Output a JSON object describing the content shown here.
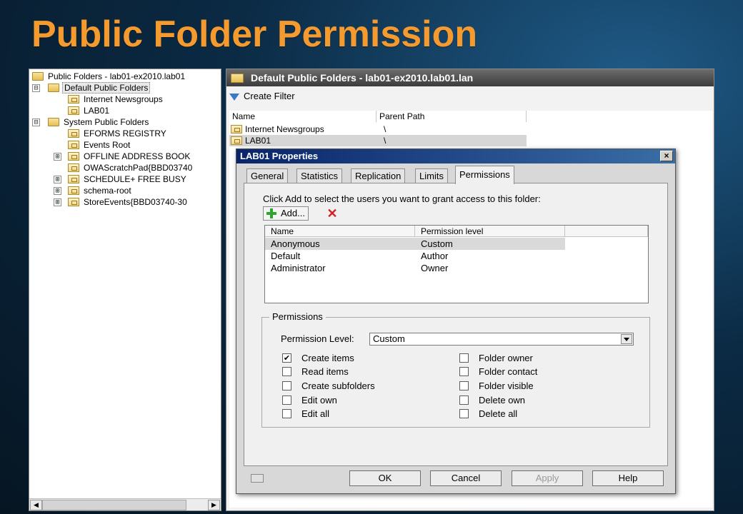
{
  "slide": {
    "title": "Public Folder Permission"
  },
  "tree": {
    "root": "Public Folders - lab01-ex2010.lab01",
    "items": [
      {
        "label": "Default Public Folders",
        "expander": "⊟",
        "selected": true
      },
      {
        "label": "Internet Newsgroups"
      },
      {
        "label": "LAB01"
      },
      {
        "label": "System Public Folders",
        "expander": "⊟"
      },
      {
        "label": "EFORMS REGISTRY"
      },
      {
        "label": "Events Root"
      },
      {
        "label": "OFFLINE ADDRESS BOOK",
        "expander": "⊞"
      },
      {
        "label": "OWAScratchPad{BBD03740"
      },
      {
        "label": "SCHEDULE+ FREE BUSY",
        "expander": "⊞"
      },
      {
        "label": "schema-root",
        "expander": "⊞"
      },
      {
        "label": "StoreEvents{BBD03740-30",
        "expander": "⊞"
      }
    ]
  },
  "list": {
    "header": "Default Public Folders - lab01-ex2010.lab01.lan",
    "toolbar_create_filter": "Create Filter",
    "columns": [
      "Name",
      "Parent Path"
    ],
    "rows": [
      {
        "name": "Internet Newsgroups",
        "parent": "\\"
      },
      {
        "name": "LAB01",
        "parent": "\\"
      }
    ]
  },
  "dialog": {
    "title": "LAB01 Properties",
    "close": "×",
    "tabs": [
      "General",
      "Statistics",
      "Replication",
      "Limits",
      "Permissions"
    ],
    "active_tab": "Permissions",
    "instruction": "Click Add to select the users you want to grant access to this folder:",
    "add_label": "Add...",
    "columns": [
      "Name",
      "Permission level"
    ],
    "entries": [
      {
        "name": "Anonymous",
        "level": "Custom"
      },
      {
        "name": "Default",
        "level": "Author"
      },
      {
        "name": "Administrator",
        "level": "Owner"
      }
    ],
    "permissions_group": "Permissions",
    "level_label": "Permission Level:",
    "level_value": "Custom",
    "checkboxes_left": [
      {
        "label": "Create items",
        "checked": true,
        "mark": "✔"
      },
      {
        "label": "Read items",
        "checked": false,
        "mark": ""
      },
      {
        "label": "Create subfolders",
        "checked": false,
        "mark": ""
      },
      {
        "label": "Edit own",
        "checked": false,
        "mark": ""
      },
      {
        "label": "Edit all",
        "checked": false,
        "mark": ""
      }
    ],
    "checkboxes_right": [
      {
        "label": "Folder owner",
        "checked": false,
        "mark": ""
      },
      {
        "label": "Folder contact",
        "checked": false,
        "mark": ""
      },
      {
        "label": "Folder visible",
        "checked": false,
        "mark": ""
      },
      {
        "label": "Delete own",
        "checked": false,
        "mark": ""
      },
      {
        "label": "Delete all",
        "checked": false,
        "mark": ""
      }
    ],
    "buttons": {
      "ok": "OK",
      "cancel": "Cancel",
      "apply": "Apply",
      "help": "Help"
    }
  }
}
